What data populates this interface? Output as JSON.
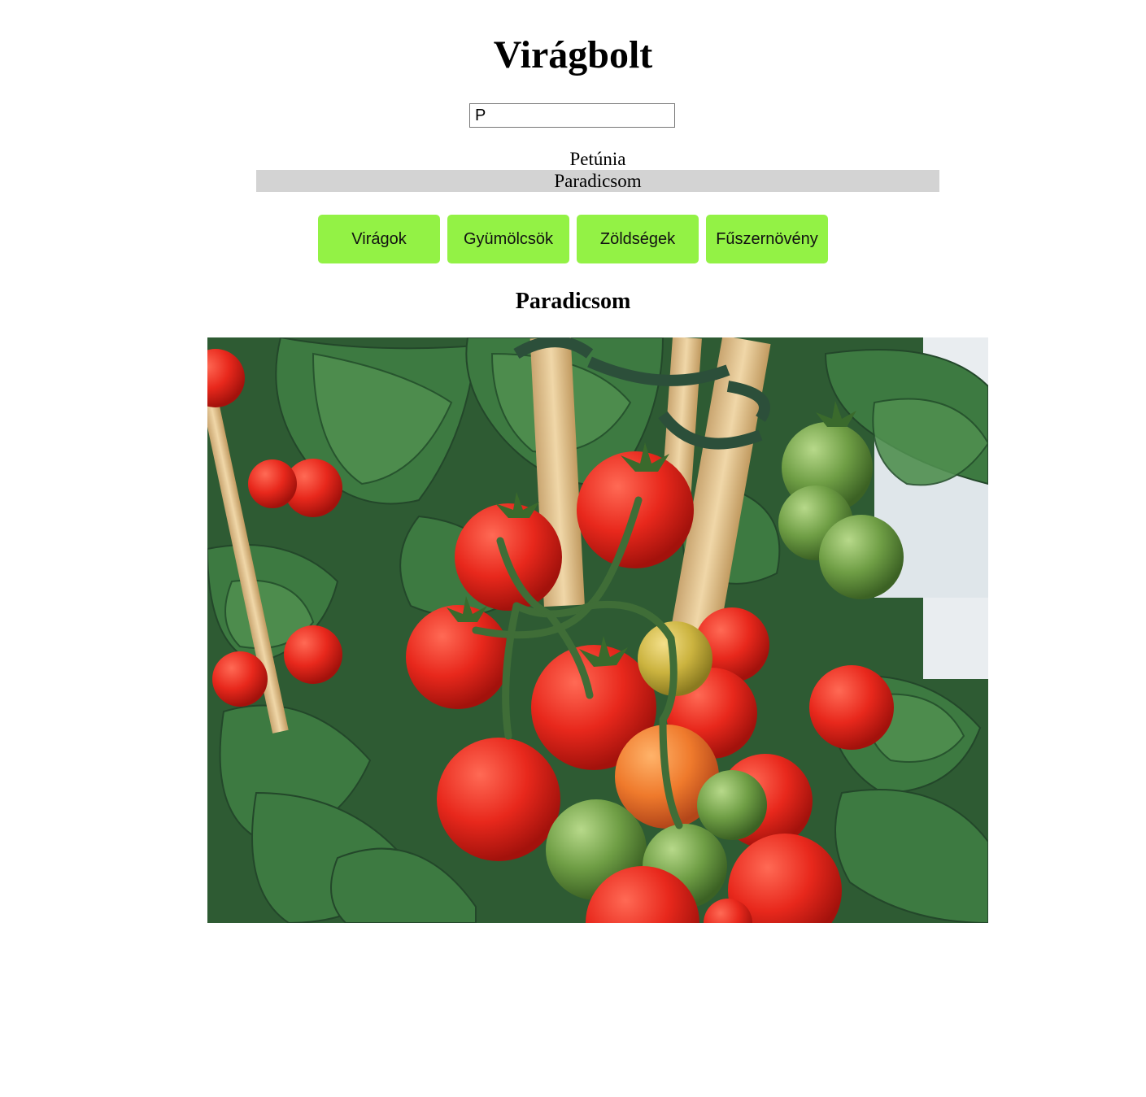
{
  "page": {
    "title": "Virágbolt"
  },
  "search": {
    "value": "P"
  },
  "suggestions": [
    {
      "label": "Petúnia",
      "active": false
    },
    {
      "label": "Paradicsom",
      "active": true
    }
  ],
  "categories": [
    {
      "label": "Virágok"
    },
    {
      "label": "Gyümölcsök"
    },
    {
      "label": "Zöldségek"
    },
    {
      "label": "Fűszernövény"
    }
  ],
  "product": {
    "name": "Paradicsom",
    "image_subject": "tomato-plant-photo"
  },
  "colors": {
    "category_button": "#93f245",
    "suggestion_highlight": "#d3d3d3"
  }
}
